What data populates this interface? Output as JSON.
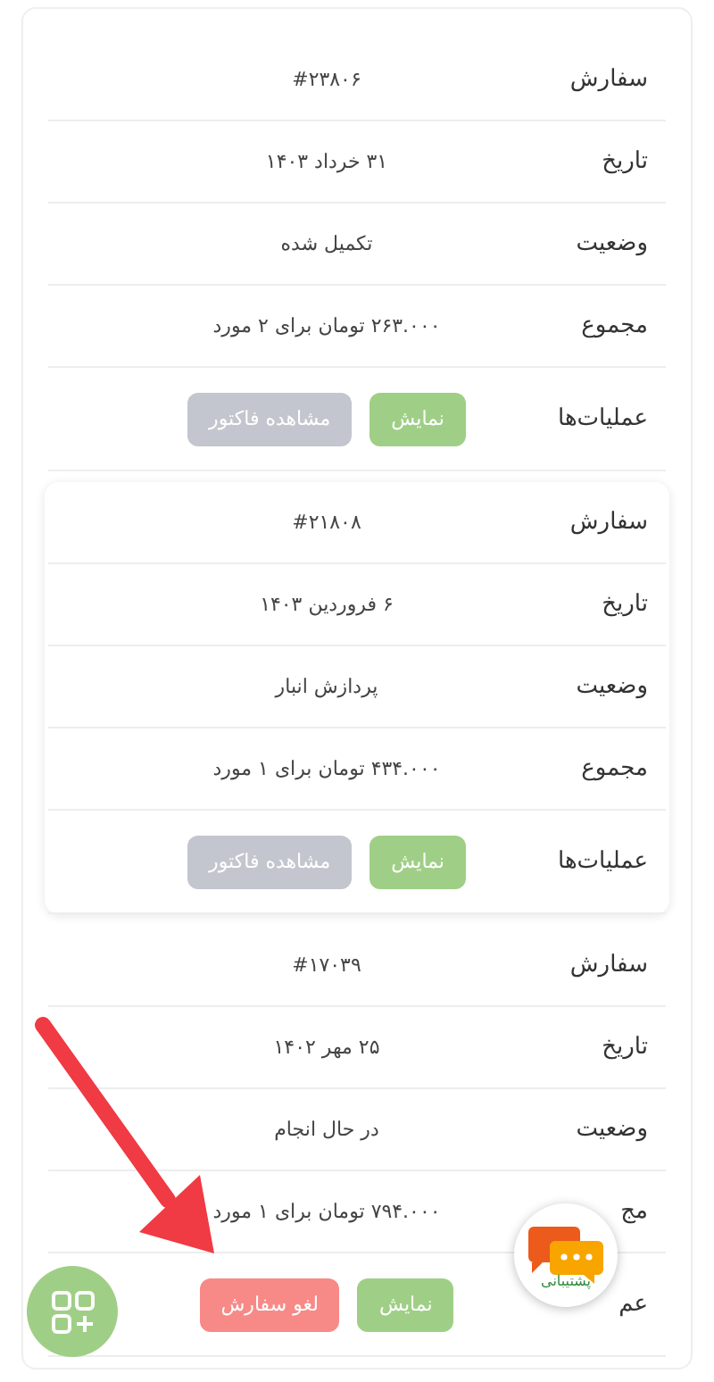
{
  "orders": [
    {
      "highlighted": false,
      "fields": [
        {
          "label": "سفارش",
          "value": "#۲۳۸۰۶"
        },
        {
          "label": "تاریخ",
          "value": "۳۱ خرداد ۱۴۰۳"
        },
        {
          "label": "وضعیت",
          "value": "تکمیل شده"
        },
        {
          "label": "مجموع",
          "value": "۲۶۳.۰۰۰ تومان برای ۲ مورد"
        }
      ],
      "actions_label": "عملیات‌ها",
      "actions": [
        {
          "kind": "show",
          "label": "نمایش"
        },
        {
          "kind": "invoice",
          "label": "مشاهده فاکتور"
        }
      ]
    },
    {
      "highlighted": true,
      "fields": [
        {
          "label": "سفارش",
          "value": "#۲۱۸۰۸"
        },
        {
          "label": "تاریخ",
          "value": "۶ فروردین ۱۴۰۳"
        },
        {
          "label": "وضعیت",
          "value": "پردازش انبار"
        },
        {
          "label": "مجموع",
          "value": "۴۳۴.۰۰۰ تومان برای ۱ مورد"
        }
      ],
      "actions_label": "عملیات‌ها",
      "actions": [
        {
          "kind": "show",
          "label": "نمایش"
        },
        {
          "kind": "invoice",
          "label": "مشاهده فاکتور"
        }
      ]
    },
    {
      "highlighted": false,
      "fields": [
        {
          "label": "سفارش",
          "value": "#۱۷۰۳۹"
        },
        {
          "label": "تاریخ",
          "value": "۲۵ مهر ۱۴۰۲"
        },
        {
          "label": "وضعیت",
          "value": "در حال انجام"
        },
        {
          "label": "مج",
          "value": "۷۹۴.۰۰۰ تومان برای ۱ مورد"
        }
      ],
      "actions_label": "عم",
      "actions": [
        {
          "kind": "show",
          "label": "نمایش"
        },
        {
          "kind": "cancel",
          "label": "لغو سفارش"
        }
      ]
    }
  ],
  "support": {
    "label": "پشتیبانی"
  }
}
